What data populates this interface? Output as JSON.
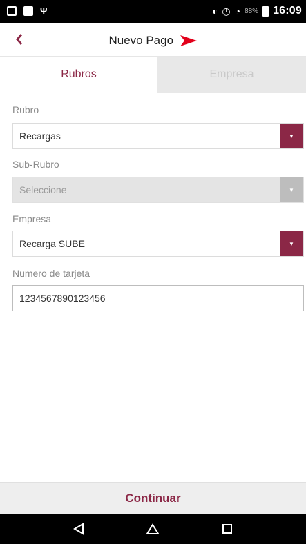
{
  "status_bar": {
    "time": "16:09",
    "battery": "88%"
  },
  "header": {
    "back_icon": "chevron-left-icon",
    "title": "Nuevo Pago"
  },
  "tabs": [
    {
      "label": "Rubros",
      "active": true
    },
    {
      "label": "Empresa",
      "active": false
    }
  ],
  "form": {
    "rubro": {
      "label": "Rubro",
      "value": "Recargas"
    },
    "sub_rubro": {
      "label": "Sub-Rubro",
      "value": "Seleccione"
    },
    "empresa": {
      "label": "Empresa",
      "value": "Recarga SUBE"
    },
    "tarjeta": {
      "label": "Numero de tarjeta",
      "value": "1234567890123456"
    }
  },
  "continue_label": "Continuar",
  "colors": {
    "accent": "#8b2746",
    "logo_red": "#e2001a",
    "disabled": "#bdbdbd"
  }
}
